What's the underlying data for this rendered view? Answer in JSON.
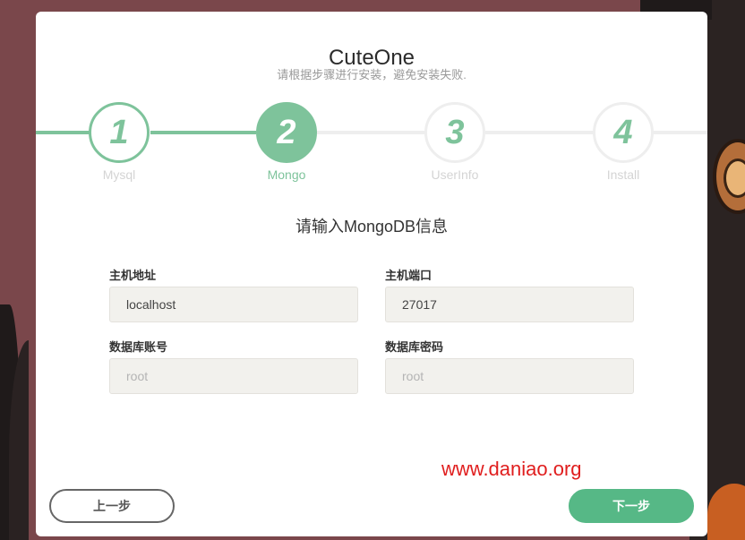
{
  "app": {
    "title": "CuteOne",
    "subtitle": "请根据步骤进行安装，避免安装失败."
  },
  "steps": [
    {
      "number": "1",
      "label": "Mysql",
      "state": "done"
    },
    {
      "number": "2",
      "label": "Mongo",
      "state": "active"
    },
    {
      "number": "3",
      "label": "UserInfo",
      "state": "pending"
    },
    {
      "number": "4",
      "label": "Install",
      "state": "pending"
    }
  ],
  "form": {
    "title": "请输入MongoDB信息",
    "host": {
      "label": "主机地址",
      "value": "localhost",
      "placeholder": ""
    },
    "port": {
      "label": "主机端口",
      "value": "27017",
      "placeholder": ""
    },
    "username": {
      "label": "数据库账号",
      "value": "",
      "placeholder": "root"
    },
    "password": {
      "label": "数据库密码",
      "value": "",
      "placeholder": "root"
    }
  },
  "buttons": {
    "prev": "上一步",
    "next": "下一步"
  },
  "watermark": "www.daniao.org",
  "colors": {
    "accent": "#7ec39b",
    "primary_button": "#56b886",
    "backdrop": "#7a474b",
    "watermark": "#e01e1e"
  }
}
